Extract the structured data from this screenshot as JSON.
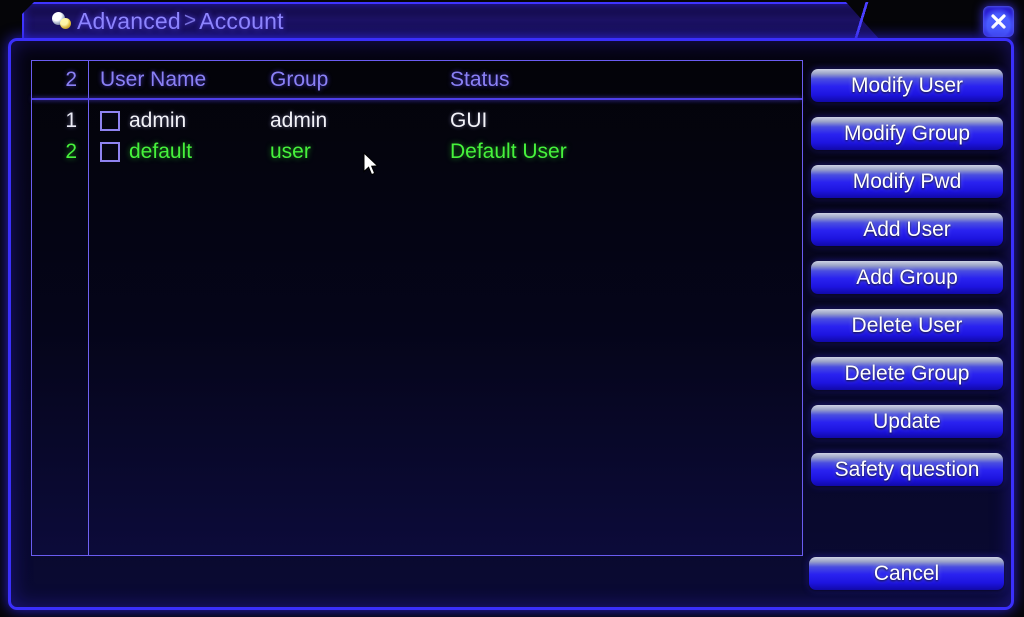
{
  "window": {
    "title_prefix": "Advanced",
    "title_separator": ">",
    "title_current": "Account",
    "title_icon": "account-key-icon",
    "close_icon": "close-icon",
    "close_label": "X"
  },
  "table": {
    "headers": {
      "count": "2",
      "user_name": "User Name",
      "group": "Group",
      "status": "Status"
    },
    "rows": [
      {
        "index": "1",
        "user_name": "admin",
        "group": "admin",
        "status": "GUI",
        "checked": false,
        "color": "#f2f2f8"
      },
      {
        "index": "2",
        "user_name": "default",
        "group": "user",
        "status": "Default User",
        "checked": false,
        "color": "#46f23c"
      }
    ]
  },
  "buttons": [
    {
      "label": "Modify User",
      "name": "modify-user-button"
    },
    {
      "label": "Modify Group",
      "name": "modify-group-button"
    },
    {
      "label": "Modify Pwd",
      "name": "modify-pwd-button"
    },
    {
      "label": "Add User",
      "name": "add-user-button"
    },
    {
      "label": "Add Group",
      "name": "add-group-button"
    },
    {
      "label": "Delete User",
      "name": "delete-user-button"
    },
    {
      "label": "Delete Group",
      "name": "delete-group-button"
    },
    {
      "label": "Update",
      "name": "update-button"
    },
    {
      "label": "Safety question",
      "name": "safety-question-button"
    }
  ],
  "cancel": {
    "label": "Cancel"
  },
  "colors": {
    "accent_border": "#3a2ffb",
    "title_text": "#8f86ff",
    "header_text": "#8a80f5",
    "value_white": "#f2f2f8",
    "value_green": "#46f23c",
    "button_blue": "#2a23f0",
    "background": "#050508"
  }
}
